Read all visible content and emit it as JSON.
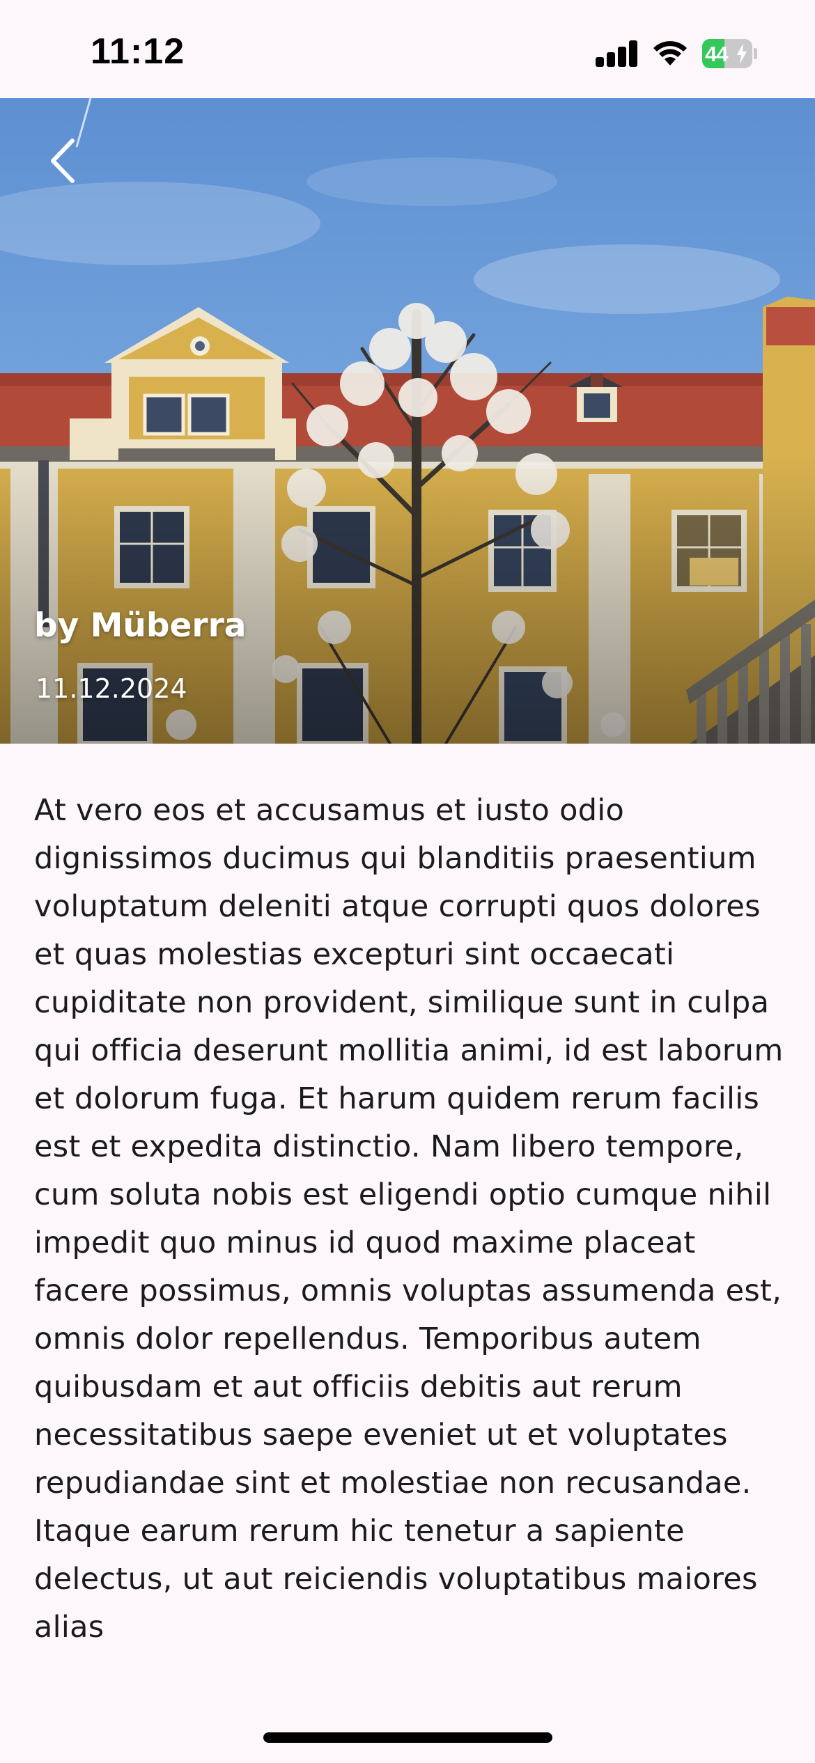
{
  "status_bar": {
    "time": "11:12",
    "battery_percent": "44",
    "battery_level": 0.44,
    "battery_color": "#34c759",
    "icons": [
      "signal-icon",
      "wifi-icon",
      "battery-icon"
    ]
  },
  "hero": {
    "back_icon": "chevron-left-icon",
    "author": "by Müberra",
    "date": "11.12.2024"
  },
  "article": {
    "body": "At vero eos et accusamus et iusto odio dignissimos ducimus qui blanditiis praesentium voluptatum deleniti atque corrupti quos dolores et quas molestias excepturi sint occaecati cupiditate non provident, similique sunt in culpa qui officia deserunt mollitia animi, id est laborum et dolorum fuga. Et harum quidem rerum facilis est et expedita distinctio. Nam libero tempore, cum soluta nobis est eligendi optio cumque nihil impedit quo minus id quod maxime placeat facere possimus, omnis voluptas assumenda est, omnis dolor repellendus. Temporibus autem quibusdam et aut officiis debitis aut rerum necessitatibus saepe eveniet ut et voluptates repudiandae sint et molestiae non recusandae. Itaque earum rerum hic tenetur a sapiente delectus, ut aut reiciendis voluptatibus maiores alias"
  }
}
